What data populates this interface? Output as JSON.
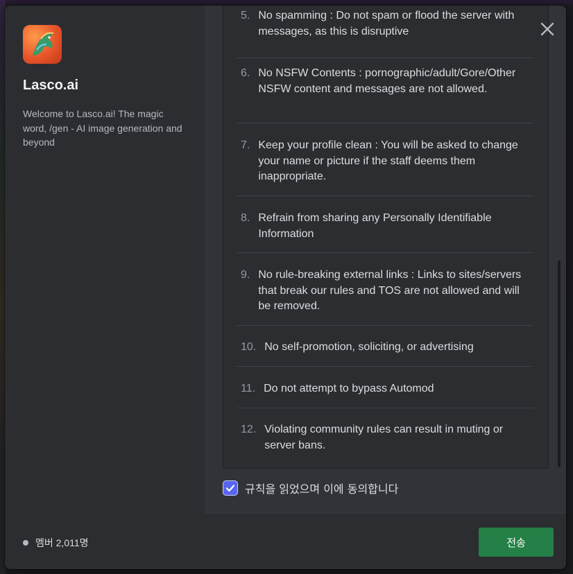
{
  "server": {
    "name": "Lasco.ai",
    "description": "Welcome to Lasco.ai! The magic word, /gen - AI image generation and beyond",
    "members": "멤버 2,011명",
    "icon": "horse-logo-icon"
  },
  "rules": [
    {
      "num": "5.",
      "text": "No spamming : Do not spam or flood the server with messages, as this is disruptive"
    },
    {
      "num": "6.",
      "text": "No NSFW Contents : pornographic/adult/Gore/Other NSFW content and messages are not allowed."
    },
    {
      "num": "7.",
      "text": "Keep your profile clean : You will be asked to change your name or picture if the staff deems them inappropriate."
    },
    {
      "num": "8.",
      "text": "Refrain from sharing any Personally Identifiable Information"
    },
    {
      "num": "9.",
      "text": "No rule-breaking external links : Links to sites/servers that break our rules and TOS are not allowed and will be removed."
    },
    {
      "num": "10.",
      "text": "No self-promotion, soliciting, or advertising"
    },
    {
      "num": "11.",
      "text": "Do not attempt to bypass Automod"
    },
    {
      "num": "12.",
      "text": "Violating community rules can result in muting or server bans."
    }
  ],
  "agree": {
    "label": "규칙을 읽었으며 이에 동의합니다",
    "checked": true
  },
  "submit_label": "전송",
  "colors": {
    "accent": "#5865f2",
    "submit": "#248046"
  }
}
